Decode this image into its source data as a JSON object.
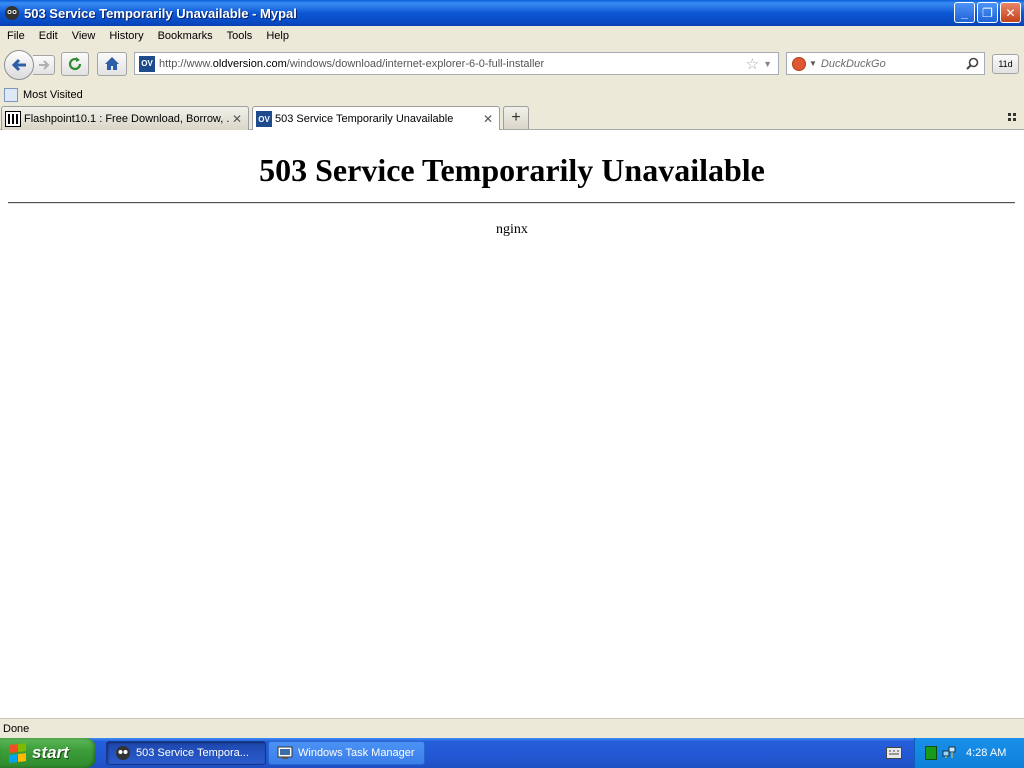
{
  "window": {
    "title": "503 Service Temporarily Unavailable - Mypal",
    "buttons": {
      "minimize": "_",
      "maximize": "❐",
      "close": "✕"
    }
  },
  "menu": [
    {
      "label": "File"
    },
    {
      "label": "Edit"
    },
    {
      "label": "View"
    },
    {
      "label": "History"
    },
    {
      "label": "Bookmarks"
    },
    {
      "label": "Tools"
    },
    {
      "label": "Help"
    }
  ],
  "navbar": {
    "url_prefix": "http://www.",
    "url_domain": "oldversion.com",
    "url_path": "/windows/download/internet-explorer-6-0-full-installer",
    "favicon_text": "OV",
    "search_placeholder": "DuckDuckGo",
    "extension_label": "11d"
  },
  "bookmarks": {
    "most_visited": "Most Visited"
  },
  "tabs": [
    {
      "label": "Flashpoint10.1 : Free Download, Borrow, ...",
      "active": false
    },
    {
      "label": "503 Service Temporarily Unavailable",
      "active": true
    }
  ],
  "content": {
    "heading": "503 Service Temporarily Unavailable",
    "server": "nginx"
  },
  "status": {
    "text": "Done"
  },
  "taskbar": {
    "start_label": "start",
    "items": [
      {
        "label": "503 Service Tempora...",
        "active": true
      },
      {
        "label": "Windows Task Manager",
        "active": false
      }
    ],
    "clock": "4:28 AM"
  },
  "colors": {
    "titlebar": "#0d58d6",
    "chrome": "#ece9d8",
    "start_green": "#3c9e3a",
    "tray_blue": "#0f7fd9"
  }
}
